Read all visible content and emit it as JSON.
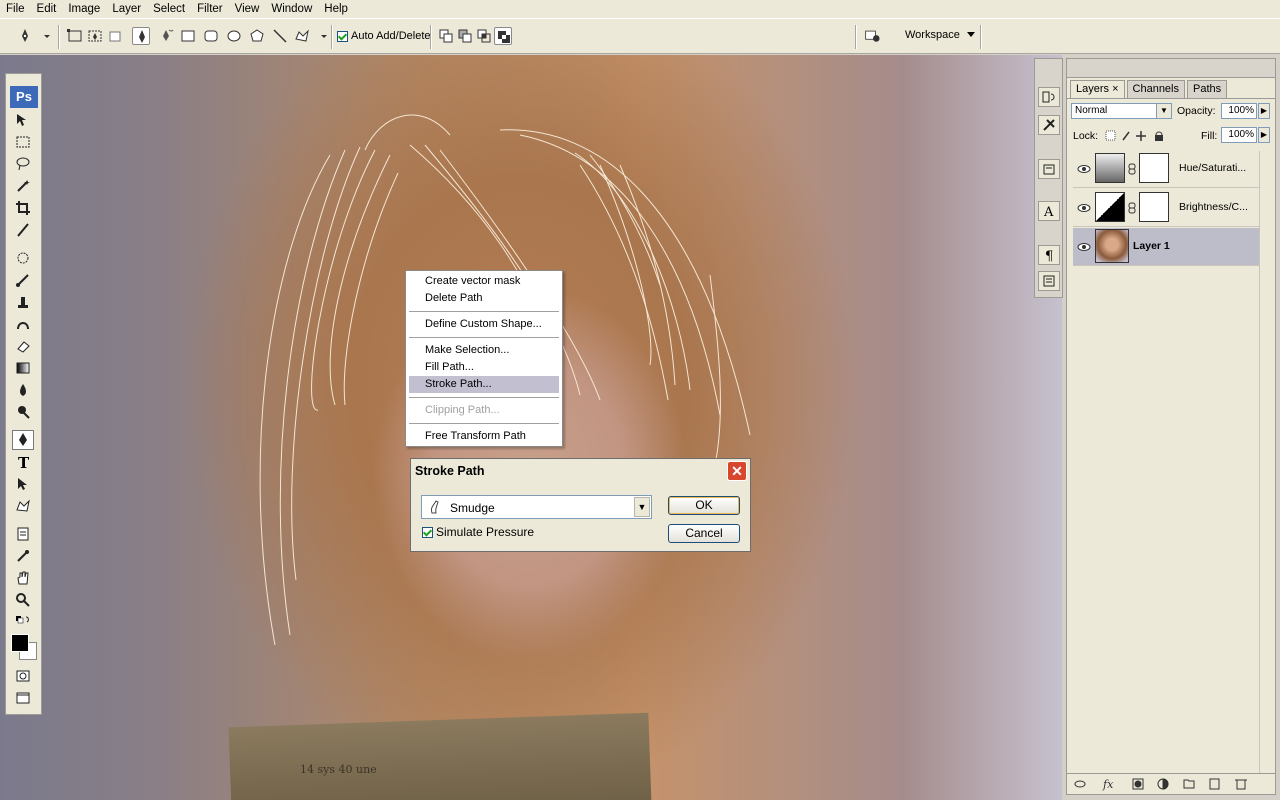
{
  "menu": [
    "File",
    "Edit",
    "Image",
    "Layer",
    "Select",
    "Filter",
    "View",
    "Window",
    "Help"
  ],
  "options_bar": {
    "auto_add_delete_label": "Auto Add/Delete",
    "auto_add_delete_checked": true,
    "workspace_label": "Workspace"
  },
  "toolbox": {
    "logo": "Ps"
  },
  "canvas": {
    "book_text": "14 sys  40 une"
  },
  "context_menu": {
    "items": [
      {
        "label": "Create vector mask",
        "state": "normal"
      },
      {
        "label": "Delete Path",
        "state": "normal"
      },
      {
        "label": "Define Custom Shape...",
        "state": "normal"
      },
      {
        "label": "Make Selection...",
        "state": "normal"
      },
      {
        "label": "Fill Path...",
        "state": "normal"
      },
      {
        "label": "Stroke Path...",
        "state": "highlighted"
      },
      {
        "label": "Clipping Path...",
        "state": "disabled"
      },
      {
        "label": "Free Transform Path",
        "state": "normal"
      }
    ]
  },
  "dialog": {
    "title": "Stroke Path",
    "tool_value": "Smudge",
    "simulate_pressure_label": "Simulate Pressure",
    "simulate_pressure_checked": true,
    "ok_label": "OK",
    "cancel_label": "Cancel"
  },
  "layers_panel": {
    "tabs": [
      {
        "label": "Layers",
        "active": true
      },
      {
        "label": "Channels",
        "active": false
      },
      {
        "label": "Paths",
        "active": false
      }
    ],
    "blend_mode": "Normal",
    "opacity_label": "Opacity:",
    "opacity_value": "100%",
    "lock_label": "Lock:",
    "fill_label": "Fill:",
    "fill_value": "100%",
    "layers": [
      {
        "name": "Hue/Saturati...",
        "selected": false
      },
      {
        "name": "Brightness/C...",
        "selected": false
      },
      {
        "name": "Layer 1",
        "selected": true
      }
    ]
  },
  "colors": {
    "accent_highlight": "#c2c0d0",
    "ps_logo": "#3d6ab8",
    "dialog_close": "#d8462e"
  }
}
